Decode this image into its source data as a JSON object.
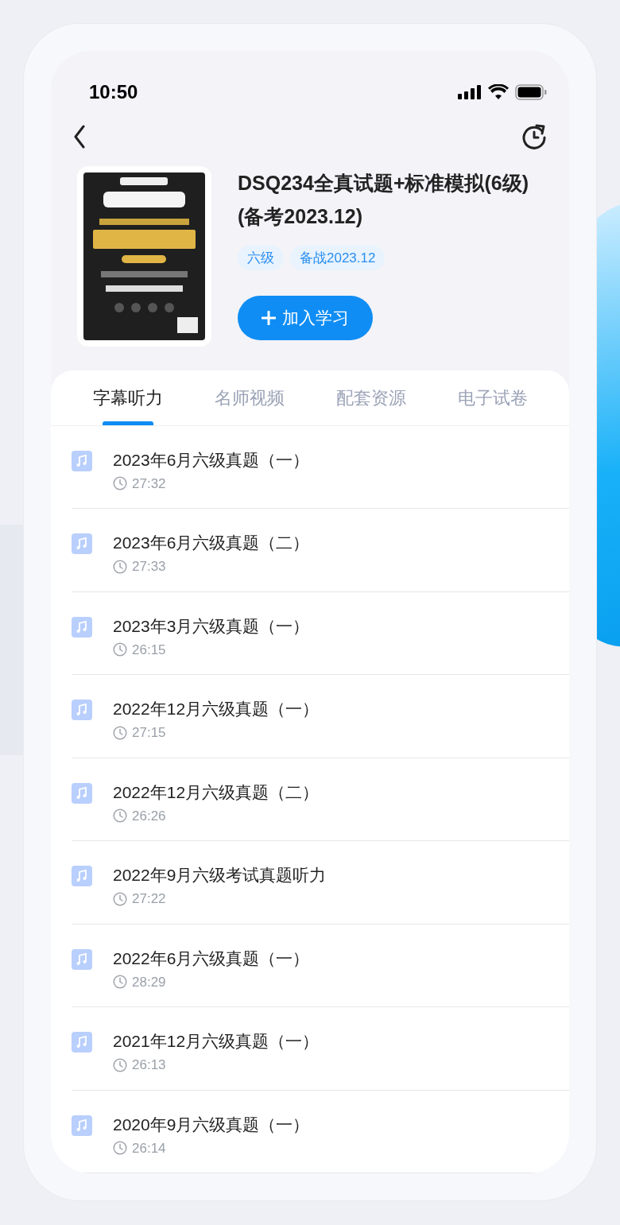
{
  "status_bar": {
    "time": "10:50"
  },
  "book": {
    "title": "DSQ234全真试题+标准模拟(6级)(备考2023.12)",
    "tags": [
      "六级",
      "备战2023.12"
    ],
    "add_button": "加入学习"
  },
  "tabs": [
    {
      "label": "字幕听力",
      "selected": true
    },
    {
      "label": "名师视频",
      "selected": false
    },
    {
      "label": "配套资源",
      "selected": false
    },
    {
      "label": "电子试卷",
      "selected": false
    }
  ],
  "items": [
    {
      "title": "2023年6月六级真题（一）",
      "duration": "27:32"
    },
    {
      "title": "2023年6月六级真题（二）",
      "duration": "27:33"
    },
    {
      "title": "2023年3月六级真题（一）",
      "duration": "26:15"
    },
    {
      "title": "2022年12月六级真题（一）",
      "duration": "27:15"
    },
    {
      "title": "2022年12月六级真题（二）",
      "duration": "26:26"
    },
    {
      "title": "2022年9月六级考试真题听力",
      "duration": "27:22"
    },
    {
      "title": "2022年6月六级真题（一）",
      "duration": "28:29"
    },
    {
      "title": "2021年12月六级真题（一）",
      "duration": "26:13"
    },
    {
      "title": "2020年9月六级真题（一）",
      "duration": "26:14"
    }
  ]
}
